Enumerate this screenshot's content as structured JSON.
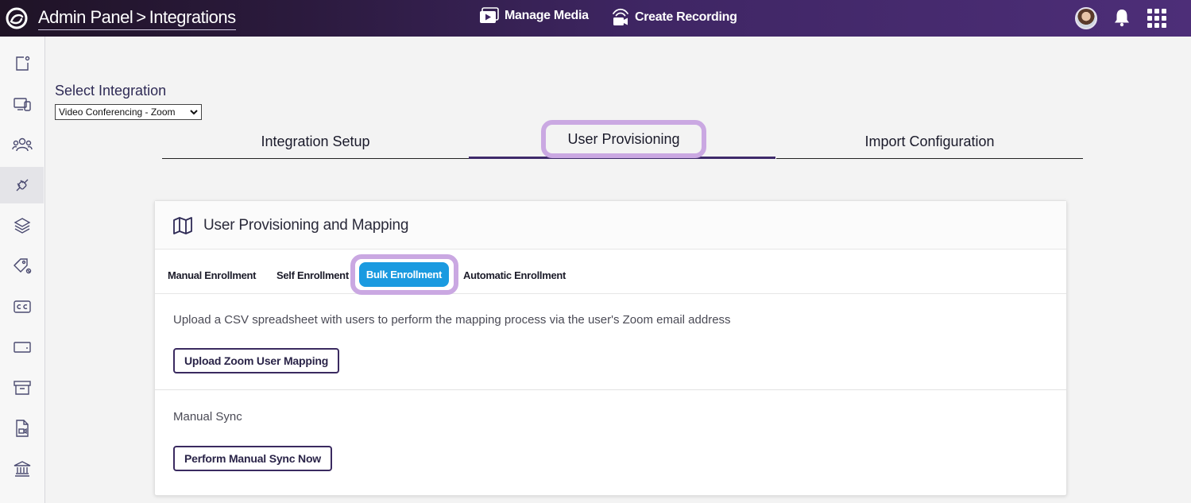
{
  "header": {
    "breadcrumb_root": "Admin Panel",
    "breadcrumb_sep": ">",
    "breadcrumb_current": "Integrations",
    "nav": [
      {
        "label": "Manage Media",
        "icon": "media-icon"
      },
      {
        "label": "Create Recording",
        "icon": "recording-icon"
      }
    ],
    "accent": "#4d2e78"
  },
  "sidebar": {
    "items": [
      {
        "icon": "dashboard-icon"
      },
      {
        "icon": "devices-icon"
      },
      {
        "icon": "users-icon"
      },
      {
        "icon": "integrations-icon",
        "active": true
      },
      {
        "icon": "layers-icon"
      },
      {
        "icon": "tag-icon"
      },
      {
        "icon": "captions-icon"
      },
      {
        "icon": "card-icon"
      },
      {
        "icon": "archive-icon"
      },
      {
        "icon": "file-video-icon"
      },
      {
        "icon": "institution-icon"
      }
    ]
  },
  "integration": {
    "select_label": "Select Integration",
    "selected": "Video Conferencing - Zoom"
  },
  "tabs": [
    {
      "label": "Integration Setup"
    },
    {
      "label": "User Provisioning",
      "active": true
    },
    {
      "label": "Import Configuration"
    }
  ],
  "card": {
    "title": "User Provisioning and Mapping",
    "subtabs": [
      {
        "label": "Manual Enrollment"
      },
      {
        "label": "Self Enrollment"
      },
      {
        "label": "Bulk Enrollment",
        "active": true
      },
      {
        "label": "Automatic Enrollment"
      }
    ],
    "description": "Upload a CSV spreadsheet with users to perform the mapping process via the user's Zoom email address",
    "upload_button": "Upload Zoom User Mapping",
    "sync_label": "Manual Sync",
    "sync_button": "Perform Manual Sync Now",
    "active_color": "#1a9ae0",
    "highlight_color": "#caa8e2"
  }
}
